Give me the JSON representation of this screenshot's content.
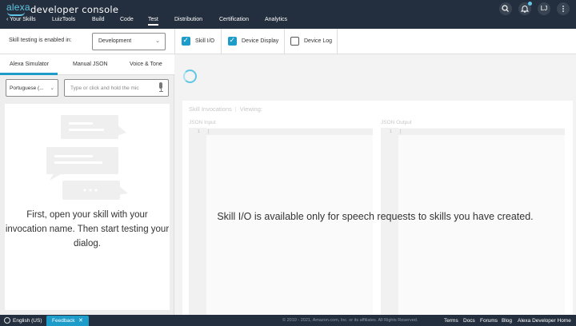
{
  "header": {
    "logo_text": "alexa",
    "title": "developer console",
    "nav": [
      {
        "label": "‹ Your Skills"
      },
      {
        "label": "LuizTools"
      },
      {
        "label": "Build"
      },
      {
        "label": "Code"
      },
      {
        "label": "Test",
        "active": true
      },
      {
        "label": "Distribution"
      },
      {
        "label": "Certification"
      },
      {
        "label": "Analytics"
      }
    ],
    "user_initials": "LJ",
    "icons": [
      "search-icon",
      "bell-icon",
      "user-avatar",
      "menu-dots-icon"
    ]
  },
  "controls": {
    "testing_label": "Skill testing is enabled in:",
    "stage_value": "Development",
    "checkboxes": [
      {
        "label": "Skill I/O",
        "checked": true
      },
      {
        "label": "Device Display",
        "checked": true
      },
      {
        "label": "Device Log",
        "checked": false
      }
    ]
  },
  "simulator": {
    "tabs": [
      "Alexa Simulator",
      "Manual JSON",
      "Voice & Tone"
    ],
    "active_tab": 0,
    "locale_value": "Portuguese (...",
    "input_placeholder": "Type or click and hold the mic",
    "empty_message": "First, open your skill with your invocation name. Then start testing your dialog."
  },
  "skill_io": {
    "header_title": "Skill Invocations",
    "header_viewing": "Viewing:",
    "json_input_label": "JSON Input",
    "json_output_label": "JSON Output",
    "line_number": "1",
    "message": "Skill I/O is available only for speech requests to skills you have created."
  },
  "footer": {
    "language": "English (US)",
    "feedback_label": "Feedback",
    "copyright": "© 2010 - 2021, Amazon.com, Inc. or its affiliates. All Rights Reserved.",
    "links": [
      "Terms",
      "Docs",
      "Forums",
      "Blog",
      "Alexa Developer Home"
    ]
  },
  "colors": {
    "topbar": "#232f3e",
    "accent": "#1d9bc9",
    "logo": "#5fc7e5"
  }
}
